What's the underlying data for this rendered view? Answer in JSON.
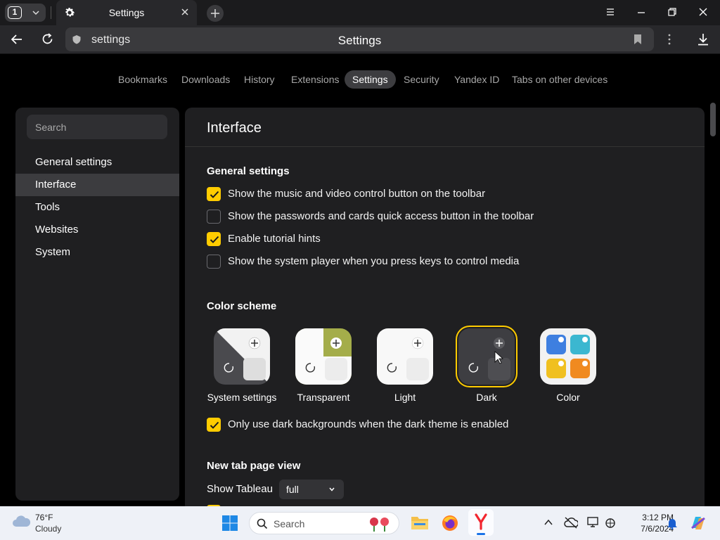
{
  "browser": {
    "tab_count": "1",
    "tab_title": "Settings",
    "address": "settings",
    "page_title": "Settings"
  },
  "topnav": [
    "Bookmarks",
    "Downloads",
    "History",
    "Extensions",
    "Settings",
    "Security",
    "Yandex ID",
    "Tabs on other devices"
  ],
  "sidebar": {
    "search_placeholder": "Search",
    "items": [
      "General settings",
      "Interface",
      "Tools",
      "Websites",
      "System"
    ]
  },
  "content": {
    "title": "Interface",
    "general_heading": "General settings",
    "general_options": [
      {
        "label": "Show the music and video control button on the toolbar",
        "checked": true
      },
      {
        "label": "Show the passwords and cards quick access button in the toolbar",
        "checked": false
      },
      {
        "label": "Enable tutorial hints",
        "checked": true
      },
      {
        "label": "Show the system player when you press keys to control media",
        "checked": false
      }
    ],
    "color_heading": "Color scheme",
    "schemes": [
      "System settings",
      "Transparent",
      "Light",
      "Dark",
      "Color"
    ],
    "selected_scheme": "Dark",
    "dark_bg_option": {
      "label": "Only use dark backgrounds when the dark theme is enabled",
      "checked": true
    },
    "newtab_heading": "New tab page view",
    "show_tableau_label": "Show Tableau",
    "show_tableau_value": "full"
  },
  "taskbar": {
    "temperature": "76°F",
    "condition": "Cloudy",
    "search_placeholder": "Search",
    "time": "3:12 PM",
    "date": "7/6/2024"
  },
  "colors": {
    "accent": "#ffcc00",
    "background": "#000000",
    "panel": "#1f1f21"
  }
}
